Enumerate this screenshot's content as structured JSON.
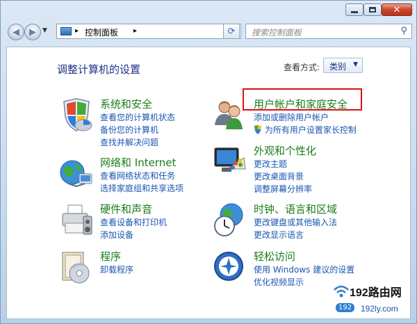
{
  "window": {
    "close_glyph": "✕"
  },
  "nav": {
    "back_glyph": "◀",
    "forward_glyph": "▶",
    "breadcrumb": [
      "控制面板"
    ],
    "search_placeholder": "搜索控制面板"
  },
  "header": {
    "title": "调整计算机的设置",
    "view_by_label": "查看方式:",
    "view_by_value": "类别"
  },
  "categories": [
    {
      "title": "系统和安全",
      "links": [
        "查看您的计算机状态",
        "备份您的计算机",
        "查找并解决问题"
      ],
      "icon": "shield-icon"
    },
    {
      "title": "网络和 Internet",
      "links": [
        "查看网络状态和任务",
        "选择家庭组和共享选项"
      ],
      "icon": "network-globe-icon"
    },
    {
      "title": "硬件和声音",
      "links": [
        "查看设备和打印机",
        "添加设备"
      ],
      "icon": "printer-icon"
    },
    {
      "title": "程序",
      "links": [
        "卸载程序"
      ],
      "icon": "programs-icon"
    },
    {
      "title": "用户帐户和家庭安全",
      "links": [
        "添加或删除用户帐户",
        "为所有用户设置家长控制"
      ],
      "icon": "users-icon"
    },
    {
      "title": "外观和个性化",
      "links": [
        "更改主题",
        "更改桌面背景",
        "调整屏幕分辨率"
      ],
      "icon": "monitor-palette-icon"
    },
    {
      "title": "时钟、语言和区域",
      "links": [
        "更改键盘或其他输入法",
        "更改显示语言"
      ],
      "icon": "clock-globe-icon"
    },
    {
      "title": "轻松访问",
      "links": [
        "使用 Windows 建议的设置",
        "优化视频显示"
      ],
      "icon": "ease-of-access-icon"
    }
  ],
  "watermark": {
    "title": "192路由网",
    "badge": "192",
    "url": "192ly.com"
  },
  "colors": {
    "category_title": "#1b7c1b",
    "link": "#1a56b2",
    "highlight_border": "#e01010"
  }
}
